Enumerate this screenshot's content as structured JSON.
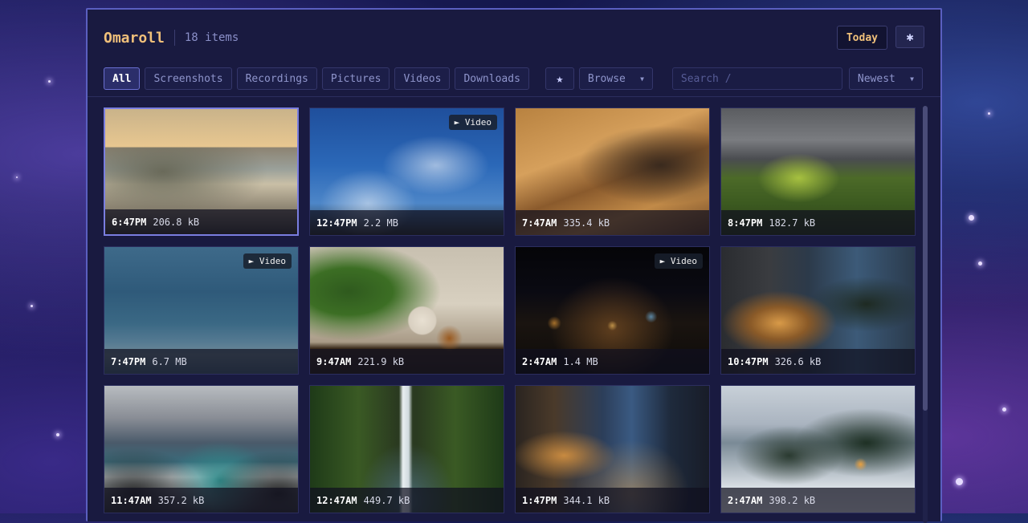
{
  "app": {
    "title": "Omaroll",
    "item_count": "18 items"
  },
  "header": {
    "today_label": "Today",
    "settings_icon": "gear-icon"
  },
  "filters": {
    "tabs": [
      {
        "label": "All",
        "active": true
      },
      {
        "label": "Screenshots",
        "active": false
      },
      {
        "label": "Recordings",
        "active": false
      },
      {
        "label": "Pictures",
        "active": false
      },
      {
        "label": "Videos",
        "active": false
      },
      {
        "label": "Downloads",
        "active": false
      }
    ],
    "favorites_icon": "star-icon",
    "browse_label": "Browse",
    "search_placeholder": "Search  /",
    "sort_label": "Newest"
  },
  "items": [
    {
      "time": "6:47PM",
      "size": "206.8 kB",
      "video": false,
      "subject": "misty mountain lake at sunset",
      "selected": true
    },
    {
      "time": "12:47PM",
      "size": "2.2 MB",
      "video": true,
      "subject": "blue sky with clouds and bare tree",
      "selected": false
    },
    {
      "time": "7:47AM",
      "size": "335.4 kB",
      "video": false,
      "subject": "desert sand dunes",
      "selected": false
    },
    {
      "time": "8:47PM",
      "size": "182.7 kB",
      "video": false,
      "subject": "green rolling hills under stormy sky",
      "selected": false
    },
    {
      "time": "7:47PM",
      "size": "6.7 MB",
      "video": true,
      "subject": "calm ocean surface",
      "selected": false
    },
    {
      "time": "9:47AM",
      "size": "221.9 kB",
      "video": false,
      "subject": "plant with ceramic vases",
      "selected": false
    },
    {
      "time": "2:47AM",
      "size": "1.4 MB",
      "video": true,
      "subject": "city lights at night",
      "selected": false
    },
    {
      "time": "10:47PM",
      "size": "326.6 kB",
      "video": false,
      "subject": "modern concrete house with tree at dusk",
      "selected": false
    },
    {
      "time": "11:47AM",
      "size": "357.2 kB",
      "video": false,
      "subject": "waves crashing on rocks",
      "selected": false
    },
    {
      "time": "12:47AM",
      "size": "449.7 kB",
      "video": false,
      "subject": "waterfall in mossy canyon",
      "selected": false
    },
    {
      "time": "1:47PM",
      "size": "344.1 kB",
      "video": false,
      "subject": "wet city street at dusk",
      "selected": false
    },
    {
      "time": "2:47AM",
      "size": "398.2 kB",
      "video": false,
      "subject": "snowy pine forest with cabin",
      "selected": false
    }
  ],
  "video_badge_label": "► Video"
}
